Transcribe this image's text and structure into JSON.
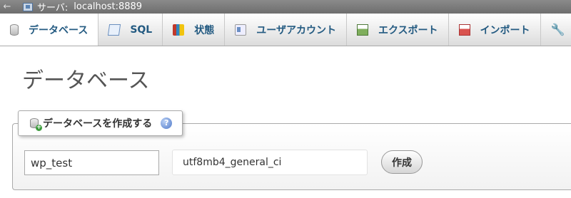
{
  "server_bar": {
    "back_glyph": "←",
    "server_label": "サーバ:",
    "server_value": "localhost:8889",
    "server_icon": "server-icon"
  },
  "tabs": [
    {
      "label": "データベース",
      "icon": "database-icon",
      "active": true
    },
    {
      "label": "SQL",
      "icon": "sql-icon",
      "active": false
    },
    {
      "label": "状態",
      "icon": "status-icon",
      "active": false
    },
    {
      "label": "ユーザアカウント",
      "icon": "users-icon",
      "active": false
    },
    {
      "label": "エクスポート",
      "icon": "export-icon",
      "active": false
    },
    {
      "label": "インポート",
      "icon": "import-icon",
      "active": false
    },
    {
      "label": "",
      "icon": "wrench-icon",
      "active": false
    }
  ],
  "page": {
    "title": "データベース"
  },
  "create_db": {
    "legend": "データベースを作成する",
    "help_glyph": "?",
    "db_name_value": "wp_test",
    "collation_value": "utf8mb4_general_ci",
    "create_button_label": "作成"
  },
  "colors": {
    "tab_text": "#235a81",
    "server_bar_bg": "#7a7a7a"
  }
}
